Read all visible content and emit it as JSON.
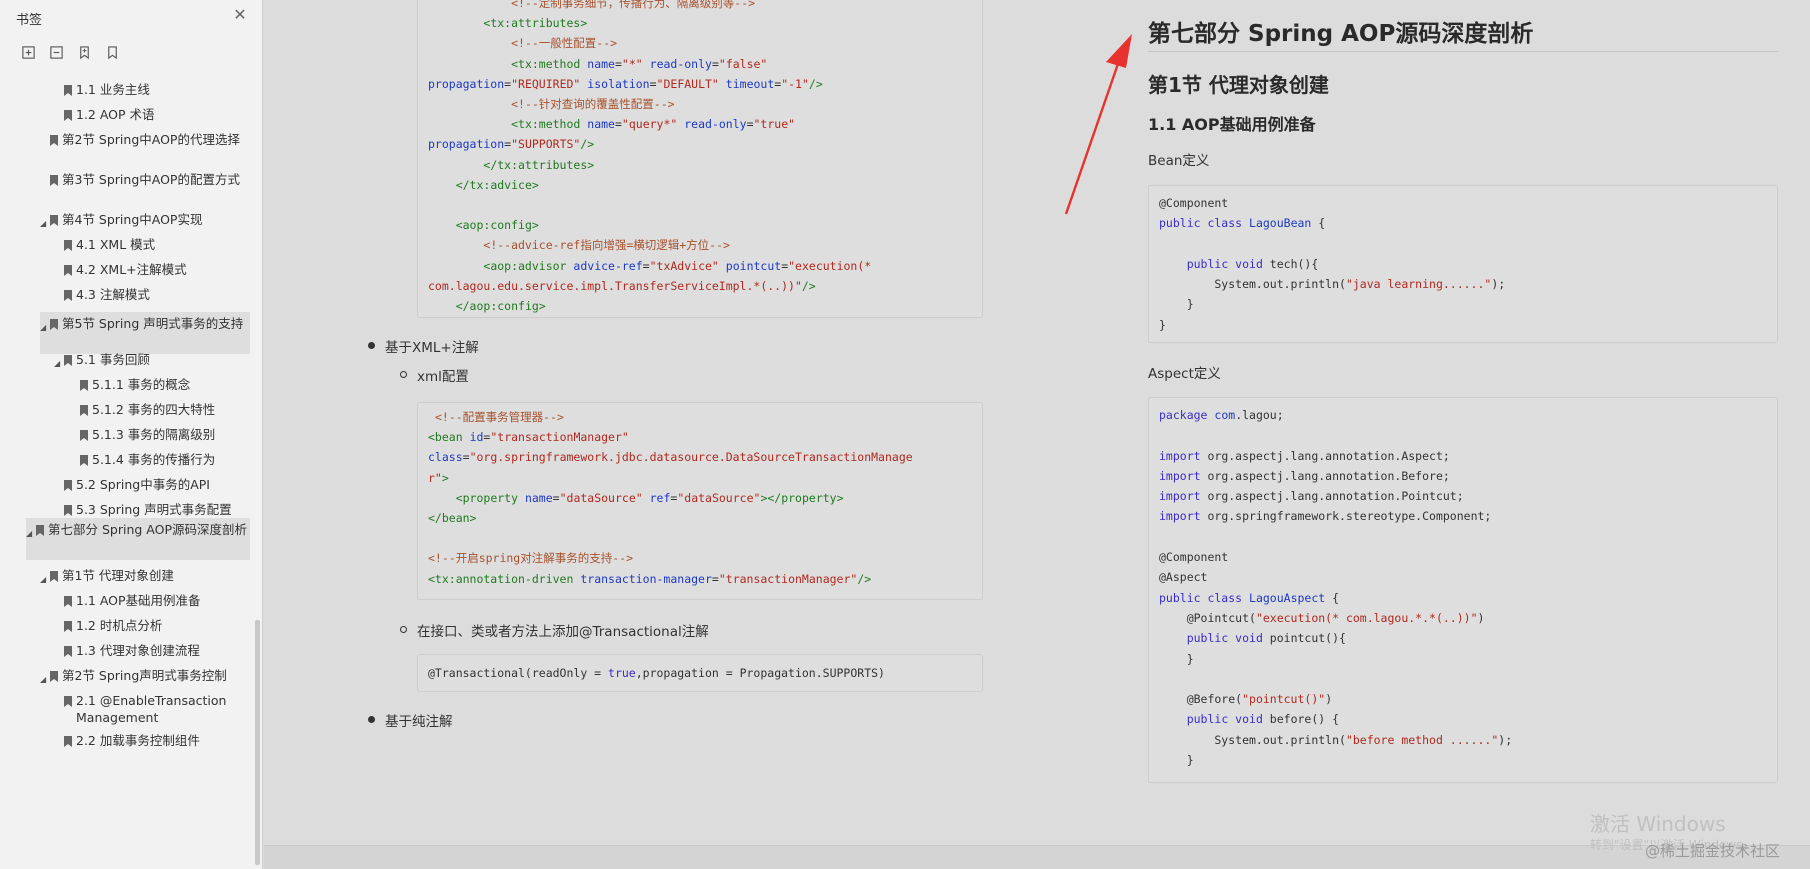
{
  "sidebar": {
    "title": "书签",
    "close_icon": "close-icon",
    "tools": [
      "expand-all-icon",
      "collapse-all-icon",
      "add-bookmark-icon",
      "bookmark-icon"
    ],
    "items": [
      {
        "label": "1.1 业务主线",
        "level": 3,
        "arrow": false
      },
      {
        "label": "1.2 AOP 术语",
        "level": 3,
        "arrow": false
      },
      {
        "label": "第2节 Spring中AOP的代理选择",
        "level": 2,
        "arrow": false
      },
      {
        "label": "第3节 Spring中AOP的配置方式",
        "level": 2,
        "arrow": false
      },
      {
        "label": "第4节 Spring中AOP实现",
        "level": 2,
        "arrow": true
      },
      {
        "label": "4.1 XML 模式",
        "level": 3,
        "arrow": false
      },
      {
        "label": "4.2 XML+注解模式",
        "level": 3,
        "arrow": false
      },
      {
        "label": "4.3 注解模式",
        "level": 3,
        "arrow": false
      },
      {
        "label": "第5节 Spring 声明式事务的支持",
        "level": 2,
        "arrow": true
      },
      {
        "label": "5.1 事务回顾",
        "level": 3,
        "arrow": true
      },
      {
        "label": "5.1.1 事务的概念",
        "level": 4,
        "arrow": false
      },
      {
        "label": "5.1.2 事务的四大特性",
        "level": 4,
        "arrow": false
      },
      {
        "label": "5.1.3 事务的隔离级别",
        "level": 4,
        "arrow": false
      },
      {
        "label": "5.1.4 事务的传播行为",
        "level": 4,
        "arrow": false
      },
      {
        "label": "5.2 Spring中事务的API",
        "level": 3,
        "arrow": false
      },
      {
        "label": "5.3 Spring 声明式事务配置",
        "level": 3,
        "arrow": false
      },
      {
        "label": "第七部分 Spring AOP源码深度剖析",
        "level": 1,
        "arrow": true,
        "selected": true
      },
      {
        "label": "第1节 代理对象创建",
        "level": 2,
        "arrow": true
      },
      {
        "label": "1.1 AOP基础用例准备",
        "level": 3,
        "arrow": false
      },
      {
        "label": "1.2 时机点分析",
        "level": 3,
        "arrow": false
      },
      {
        "label": "1.3 代理对象创建流程",
        "level": 3,
        "arrow": false
      },
      {
        "label": "第2节 Spring声明式事务控制",
        "level": 2,
        "arrow": true
      },
      {
        "label": "2.1 @EnableTransaction Management",
        "level": 3,
        "arrow": false
      },
      {
        "label": "2.2 加载事务控制组件",
        "level": 3,
        "arrow": false
      }
    ]
  },
  "left_page": {
    "bullet_xml_annotation": "基于XML+注解",
    "sub_xml_config": "xml配置",
    "sub_interface": "在接口、类或者方法上添加@Transactional注解",
    "bullet_pure_annotation": "基于纯注解"
  },
  "right_page": {
    "part_title": "第七部分 Spring AOP源码深度剖析",
    "section_title": "第1节 代理对象创建",
    "subsection_title": "1.1 AOP基础用例准备",
    "bean_label": "Bean定义",
    "aspect_label": "Aspect定义"
  },
  "watermark": {
    "line1": "激活 Windows",
    "line2": "转到\"设置\"以激活 Windows。",
    "line3": "@稀土掘金技术社区"
  },
  "colors": {
    "annotation_arrow": "#e8322d",
    "code_comment": "#a7522e",
    "code_tag": "#207a20",
    "code_attr": "#1d39c4",
    "code_string": "#b0291f"
  }
}
